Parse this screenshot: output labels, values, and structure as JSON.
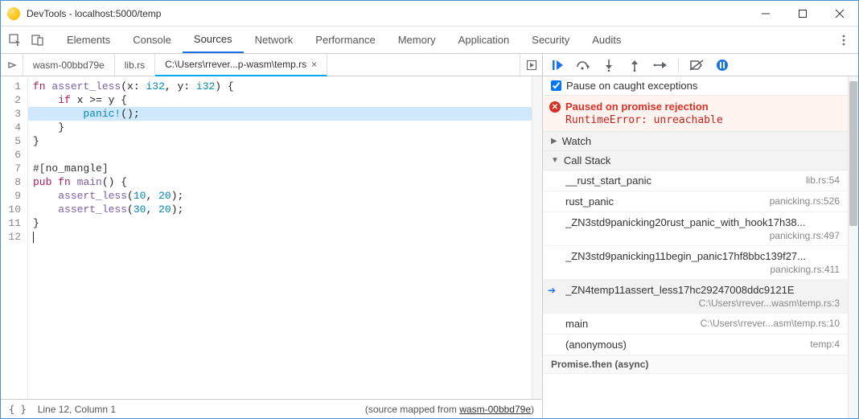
{
  "window": {
    "title": "DevTools - localhost:5000/temp"
  },
  "toolbar_tabs": [
    "Elements",
    "Console",
    "Sources",
    "Network",
    "Performance",
    "Memory",
    "Application",
    "Security",
    "Audits"
  ],
  "toolbar_active_index": 2,
  "file_tabs": {
    "items": [
      "wasm-00bbd79e",
      "lib.rs",
      "C:\\Users\\rrever...p-wasm\\temp.rs"
    ],
    "active_index": 2
  },
  "code": {
    "lines": [
      "fn assert_less(x: i32, y: i32) {",
      "    if x >= y {",
      "        panic!();",
      "    }",
      "}",
      "",
      "#[no_mangle]",
      "pub fn main() {",
      "    assert_less(10, 20);",
      "    assert_less(30, 20);",
      "}",
      ""
    ],
    "highlight_line": 3
  },
  "status": {
    "cursor": "Line 12, Column 1",
    "mapping_prefix": "(source mapped from ",
    "mapping_link": "wasm-00bbd79e",
    "mapping_suffix": ")"
  },
  "debugger": {
    "pause_caught_label": "Pause on caught exceptions",
    "pause_caught_checked": true,
    "paused": {
      "reason": "Paused on promise rejection",
      "detail": "RuntimeError: unreachable"
    },
    "sections": {
      "watch": "Watch",
      "callstack": "Call Stack"
    },
    "call_stack": [
      {
        "fn": "__rust_start_panic",
        "loc": "lib.rs:54"
      },
      {
        "fn": "rust_panic",
        "loc": "panicking.rs:526"
      },
      {
        "fn": "_ZN3std9panicking20rust_panic_with_hook17h38...",
        "loc": "panicking.rs:497",
        "twoline": true
      },
      {
        "fn": "_ZN3std9panicking11begin_panic17hf8bbc139f27...",
        "loc": "panicking.rs:411",
        "twoline": true
      },
      {
        "fn": "_ZN4temp11assert_less17hc29247008ddc9121E",
        "loc": "C:\\Users\\rrever...wasm\\temp.rs:3",
        "current": true,
        "twoline": true
      },
      {
        "fn": "main",
        "loc": "C:\\Users\\rrever...asm\\temp.rs:10"
      },
      {
        "fn": "(anonymous)",
        "loc": "temp:4"
      }
    ],
    "async_group": "Promise.then (async)"
  }
}
